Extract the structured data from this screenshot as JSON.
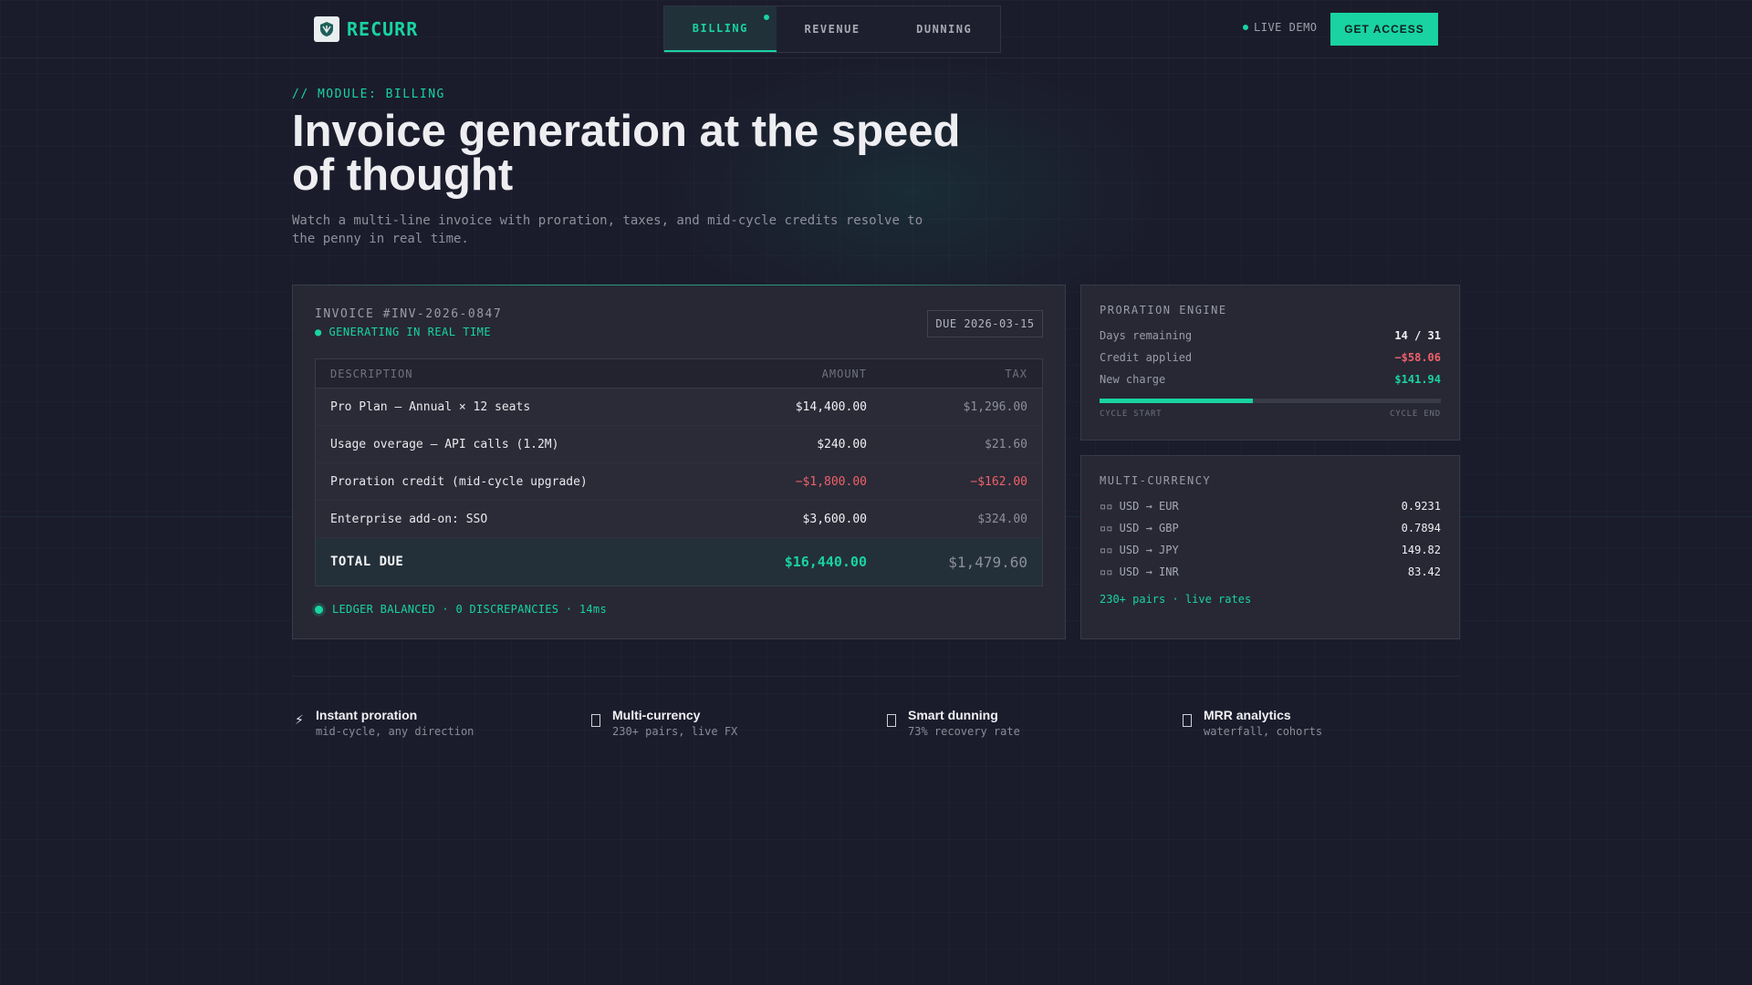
{
  "brand": {
    "name": "RECURR"
  },
  "nav": {
    "tabs": [
      {
        "label": "BILLING",
        "active": true
      },
      {
        "label": "REVENUE",
        "active": false
      },
      {
        "label": "DUNNING",
        "active": false
      }
    ],
    "live_label": "LIVE DEMO",
    "cta_label": "GET ACCESS"
  },
  "hero": {
    "module": "// MODULE: BILLING",
    "title": "Invoice generation at the speed of thought",
    "subtitle": "Watch a multi-line invoice with proration, taxes, and mid-cycle credits resolve to the penny in real time."
  },
  "invoice": {
    "id": "INVOICE #INV-2026-0847",
    "status": "● GENERATING IN REAL TIME",
    "due": "DUE 2026-03-15",
    "columns": {
      "description": "DESCRIPTION",
      "amount": "AMOUNT",
      "tax": "TAX"
    },
    "rows": [
      {
        "description": "Pro Plan — Annual × 12 seats",
        "amount": "$14,400.00",
        "tax": "$1,296.00"
      },
      {
        "description": "Usage overage — API calls (1.2M)",
        "amount": "$240.00",
        "tax": "$21.60"
      },
      {
        "description": "Proration credit (mid-cycle upgrade)",
        "amount": "−$1,800.00",
        "tax": "−$162.00"
      },
      {
        "description": "Enterprise add-on: SSO",
        "amount": "$3,600.00",
        "tax": "$324.00"
      }
    ],
    "total": {
      "label": "TOTAL DUE",
      "amount": "$16,440.00",
      "tax": "$1,479.60"
    },
    "ledger": "LEDGER BALANCED · 0 DISCREPANCIES · 14ms"
  },
  "proration": {
    "title": "PRORATION ENGINE",
    "rows": [
      {
        "label": "Days remaining",
        "value": "14 / 31"
      },
      {
        "label": "Credit applied",
        "value": "−$58.06"
      },
      {
        "label": "New charge",
        "value": "$141.94"
      }
    ],
    "progress": 0.45,
    "start_label": "CYCLE START",
    "end_label": "CYCLE END"
  },
  "currency": {
    "title": "MULTI-CURRENCY",
    "rows": [
      {
        "pair": "▫▫ USD → EUR",
        "rate": "0.9231"
      },
      {
        "pair": "▫▫ USD → GBP",
        "rate": "0.7894"
      },
      {
        "pair": "▫▫ USD → JPY",
        "rate": "149.82"
      },
      {
        "pair": "▫▫ USD → INR",
        "rate": "83.42"
      }
    ],
    "footer": "230+ pairs · live rates"
  },
  "features": [
    {
      "icon": "lightning-icon",
      "title": "Instant proration",
      "subtitle": "mid-cycle, any direction"
    },
    {
      "icon": "box-icon",
      "title": "Multi-currency",
      "subtitle": "230+ pairs, live FX"
    },
    {
      "icon": "box-icon",
      "title": "Smart dunning",
      "subtitle": "73% recovery rate"
    },
    {
      "icon": "box-icon",
      "title": "MRR analytics",
      "subtitle": "waterfall, cohorts"
    }
  ],
  "colors": {
    "accent": "#19d3a2",
    "negative": "#f0606a",
    "background": "#1b1c2b",
    "panel": "#272834"
  }
}
